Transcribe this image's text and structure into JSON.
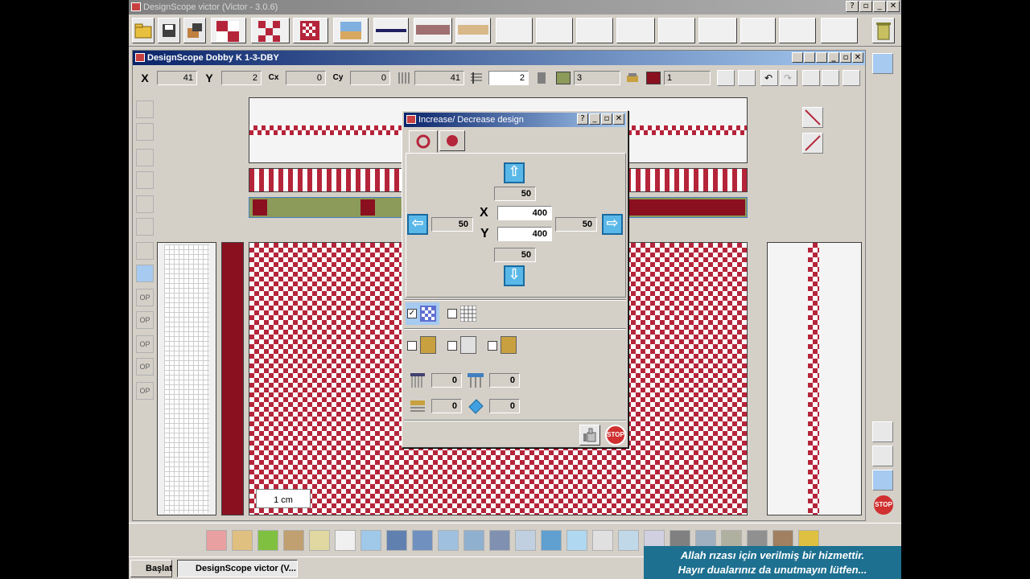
{
  "app": {
    "title": "DesignScope victor (Victor - 3.0.6)",
    "window_buttons": [
      "?",
      "▫",
      "_",
      "✕"
    ]
  },
  "document": {
    "title": "DesignScope Dobby K 1-3-DBY"
  },
  "coords": {
    "x_label": "X",
    "x_value": "41",
    "y_label": "Y",
    "y_value": "2",
    "cx_label": "Cx",
    "cx_value": "0",
    "cy_label": "Cy",
    "cy_value": "0",
    "warp_value": "41",
    "weft_value": "2",
    "color1_value": "3",
    "color2_value": "1",
    "color1": "#8c9a5a",
    "color2": "#8a1020"
  },
  "dialog": {
    "title": "Increase/ Decrease design",
    "top_value": "50",
    "left_value": "50",
    "right_value": "50",
    "bottom_value": "50",
    "x_label": "X",
    "x_value": "400",
    "y_label": "Y",
    "y_value": "400",
    "up_arrow": "⇧",
    "down_arrow": "⇩",
    "left_arrow": "⇦",
    "right_arrow": "⇨",
    "field_a": "0",
    "field_b": "0",
    "field_c": "0",
    "field_d": "0",
    "check_mark": "✓",
    "stop_label": "STOP"
  },
  "scale": {
    "label": "1 cm"
  },
  "left_panel": {
    "op_labels": [
      "OP",
      "OP",
      "OP",
      "OP",
      "OP"
    ]
  },
  "right_panel": {
    "stop_label": "STOP"
  },
  "taskbar": {
    "start_label": "Başlat",
    "task_label": "DesignScope victor (V..."
  },
  "overlay": {
    "line1": "Allah rızası için verilmiş bir hizmettir.",
    "line2": "Hayır dualarınız da unutmayın lütfen..."
  },
  "colors": {
    "red": "#b5253a",
    "dark_red": "#8a1020",
    "olive": "#8c9a5a",
    "title_blue": "#0a246a"
  }
}
